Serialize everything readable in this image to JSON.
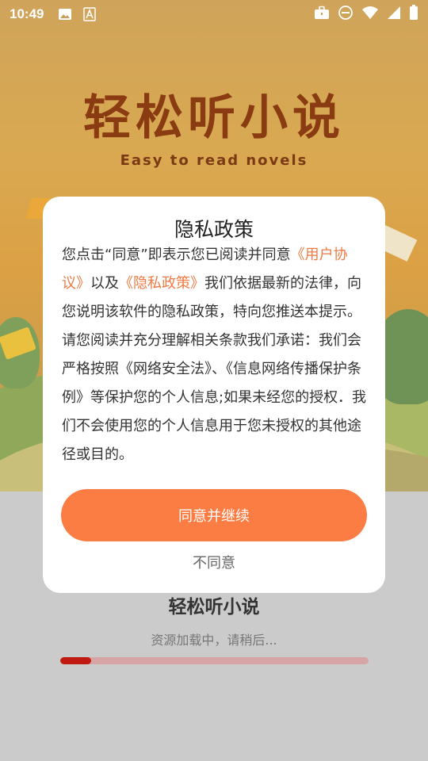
{
  "status_bar": {
    "time": "10:49",
    "left_icons": [
      "image-icon",
      "font-icon"
    ],
    "right_icons": [
      "briefcase-icon",
      "do-not-disturb-icon",
      "wifi-icon",
      "signal-icon",
      "battery-icon"
    ]
  },
  "splash": {
    "logo_title": "轻松听小说",
    "logo_subtitle": "Easy to read novels"
  },
  "dialog": {
    "title": "隐私政策",
    "body_1": "您点击“同意”即表示您已阅读并同意",
    "link_user_agreement": "《用户协议》",
    "body_2": "以及",
    "link_privacy_policy": "《隐私政策》",
    "body_3": "我们依据最新的法律，向您说明该软件的隐私政策，特向您推送本提示。请您阅读并充分理解相关条款我们承诺：我们会严格按照《网络安全法》、《信息网络传播保护条例》等保护您的个人信息;如果未经您的授权．我们不会使用您的个人信息用于您未授权的其他途径或目的。",
    "agree_label": "同意并继续",
    "disagree_label": "不同意"
  },
  "loading": {
    "app_name": "轻松听小说",
    "status_text": "资源加载中，请稍后...",
    "progress": 0.1
  },
  "colors": {
    "accent": "#fb7d43",
    "link": "#f07a43",
    "progress_fill": "#c01a11",
    "progress_track": "#d7a5a5"
  }
}
